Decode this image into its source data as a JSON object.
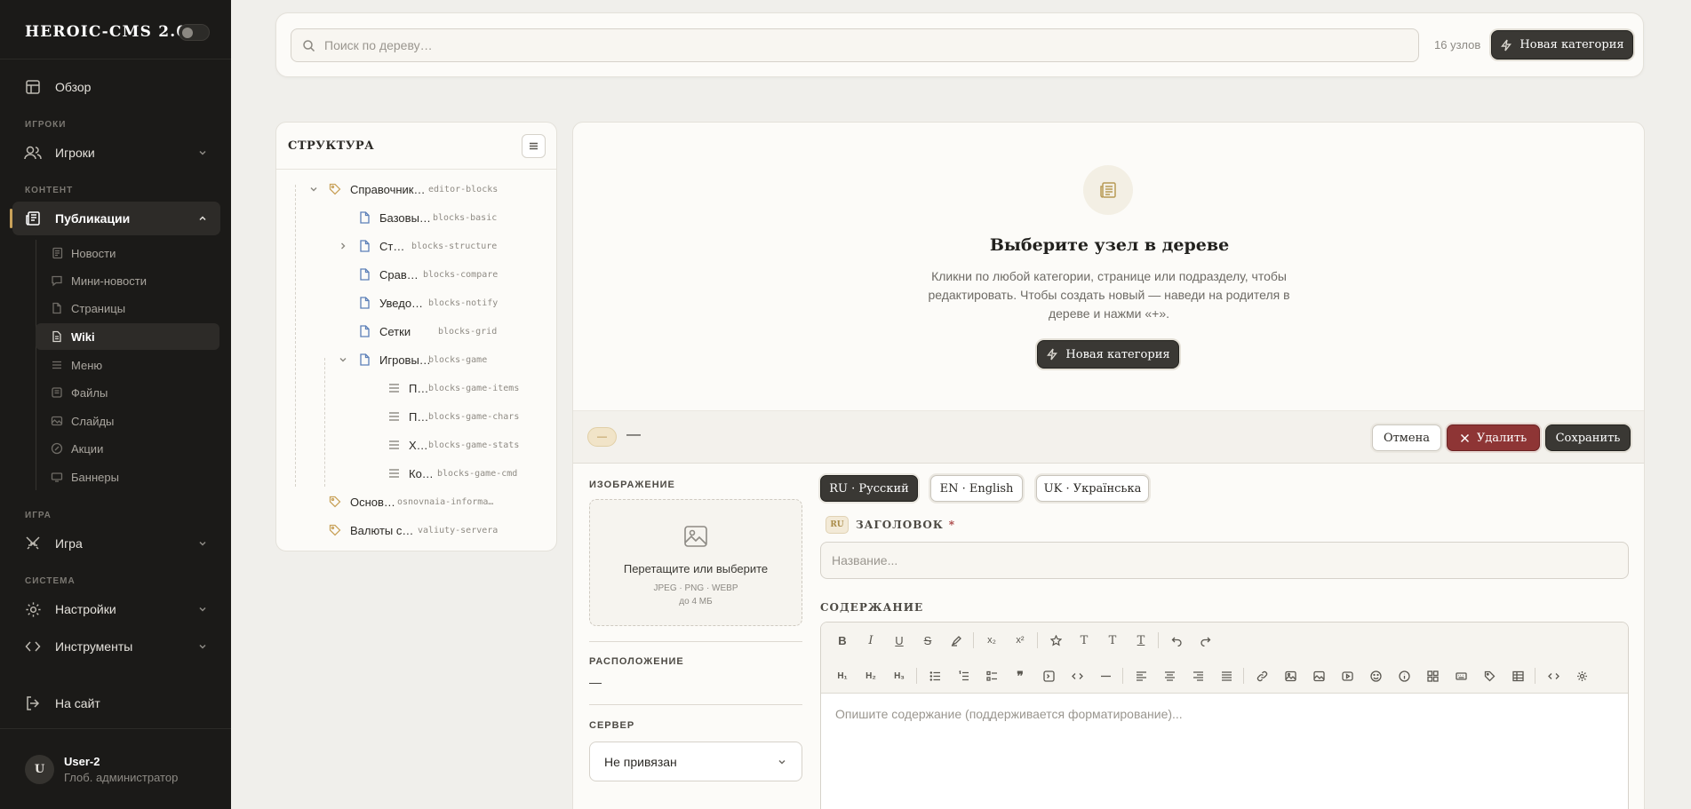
{
  "app": {
    "brand": "HEROIC-CMS 2.0",
    "toggle_glyph": "☾"
  },
  "nav": {
    "overview": "Обзор",
    "section_players": "ИГРОКИ",
    "players": "Игроки",
    "section_content": "КОНТЕНТ",
    "publications": "Публикации",
    "sub": [
      "Новости",
      "Мини-новости",
      "Страницы",
      "Wiki",
      "Меню",
      "Файлы",
      "Слайды",
      "Акции",
      "Баннеры"
    ],
    "section_game": "ИГРА",
    "game": "Игра",
    "section_system": "СИСТЕМА",
    "settings": "Настройки",
    "tools": "Инструменты",
    "to_site": "На сайт"
  },
  "user": {
    "initial": "U",
    "name": "User-2",
    "role": "Глоб. администратор"
  },
  "topbar": {
    "search_placeholder": "Поиск по дереву…",
    "node_count": "16 узлов",
    "new_category": "Новая категория"
  },
  "tree": {
    "title": "СТРУКТУРА",
    "nodes": [
      {
        "label": "Справочник…",
        "slug": "editor-blocks",
        "icon": "tag-icon",
        "expanded": true
      },
      {
        "label": "Базовы…",
        "slug": "blocks-basic",
        "icon": "page-icon"
      },
      {
        "label": "Ст…",
        "slug": "blocks-structure",
        "icon": "page-icon",
        "expanded": false
      },
      {
        "label": "Срав…",
        "slug": "blocks-compare",
        "icon": "page-icon"
      },
      {
        "label": "Уведо…",
        "slug": "blocks-notify",
        "icon": "page-icon"
      },
      {
        "label": "Сетки",
        "slug": "blocks-grid",
        "icon": "page-icon"
      },
      {
        "label": "Игровы…",
        "slug": "blocks-game",
        "icon": "page-icon",
        "expanded": true
      },
      {
        "label": "П…",
        "slug": "blocks-game-items",
        "icon": "section-icon"
      },
      {
        "label": "П…",
        "slug": "blocks-game-chars",
        "icon": "section-icon"
      },
      {
        "label": "Х…",
        "slug": "blocks-game-stats",
        "icon": "section-icon"
      },
      {
        "label": "Ко…",
        "slug": "blocks-game-cmd",
        "icon": "section-icon"
      },
      {
        "label": "Основ…",
        "slug": "osnovnaia-informa…",
        "icon": "tag-icon"
      },
      {
        "label": "Валюты с…",
        "slug": "valiuty-servera",
        "icon": "tag-icon"
      }
    ]
  },
  "empty": {
    "title": "Выберите узел в дереве",
    "text": "Кликни по любой категории, странице или подразделу, чтобы редактировать. Чтобы создать новый — наведи на родителя в дереве и нажми «+».",
    "new_category": "Новая категория"
  },
  "editor": {
    "pill": "—",
    "title": "—",
    "cancel": "Отмена",
    "delete": "Удалить",
    "save": "Сохранить",
    "image_label": "ИЗОБРАЖЕНИЕ",
    "dropzone_main": "Перетащите или выберите",
    "dropzone_formats": "JPEG · PNG · WEBP",
    "dropzone_limit": "до 4 МБ",
    "location_label": "РАСПОЛОЖЕНИЕ",
    "location_value": "—",
    "server_label": "СЕРВЕР",
    "server_value": "Не привязан",
    "langs": [
      "RU · Русский",
      "EN · English",
      "UK · Українська"
    ],
    "active_lang_badge": "RU",
    "heading_label": "ЗАГОЛОВОК",
    "required_mark": "*",
    "heading_placeholder": "Название...",
    "content_label": "СОДЕРЖАНИЕ",
    "content_placeholder": "Опишите содержание (поддерживается форматирование)..."
  },
  "colors": {
    "sidebar_bg": "#1b1a18",
    "accent_gold": "#c9a25a",
    "danger": "#8e3535",
    "dark_button": "#3a3834"
  }
}
